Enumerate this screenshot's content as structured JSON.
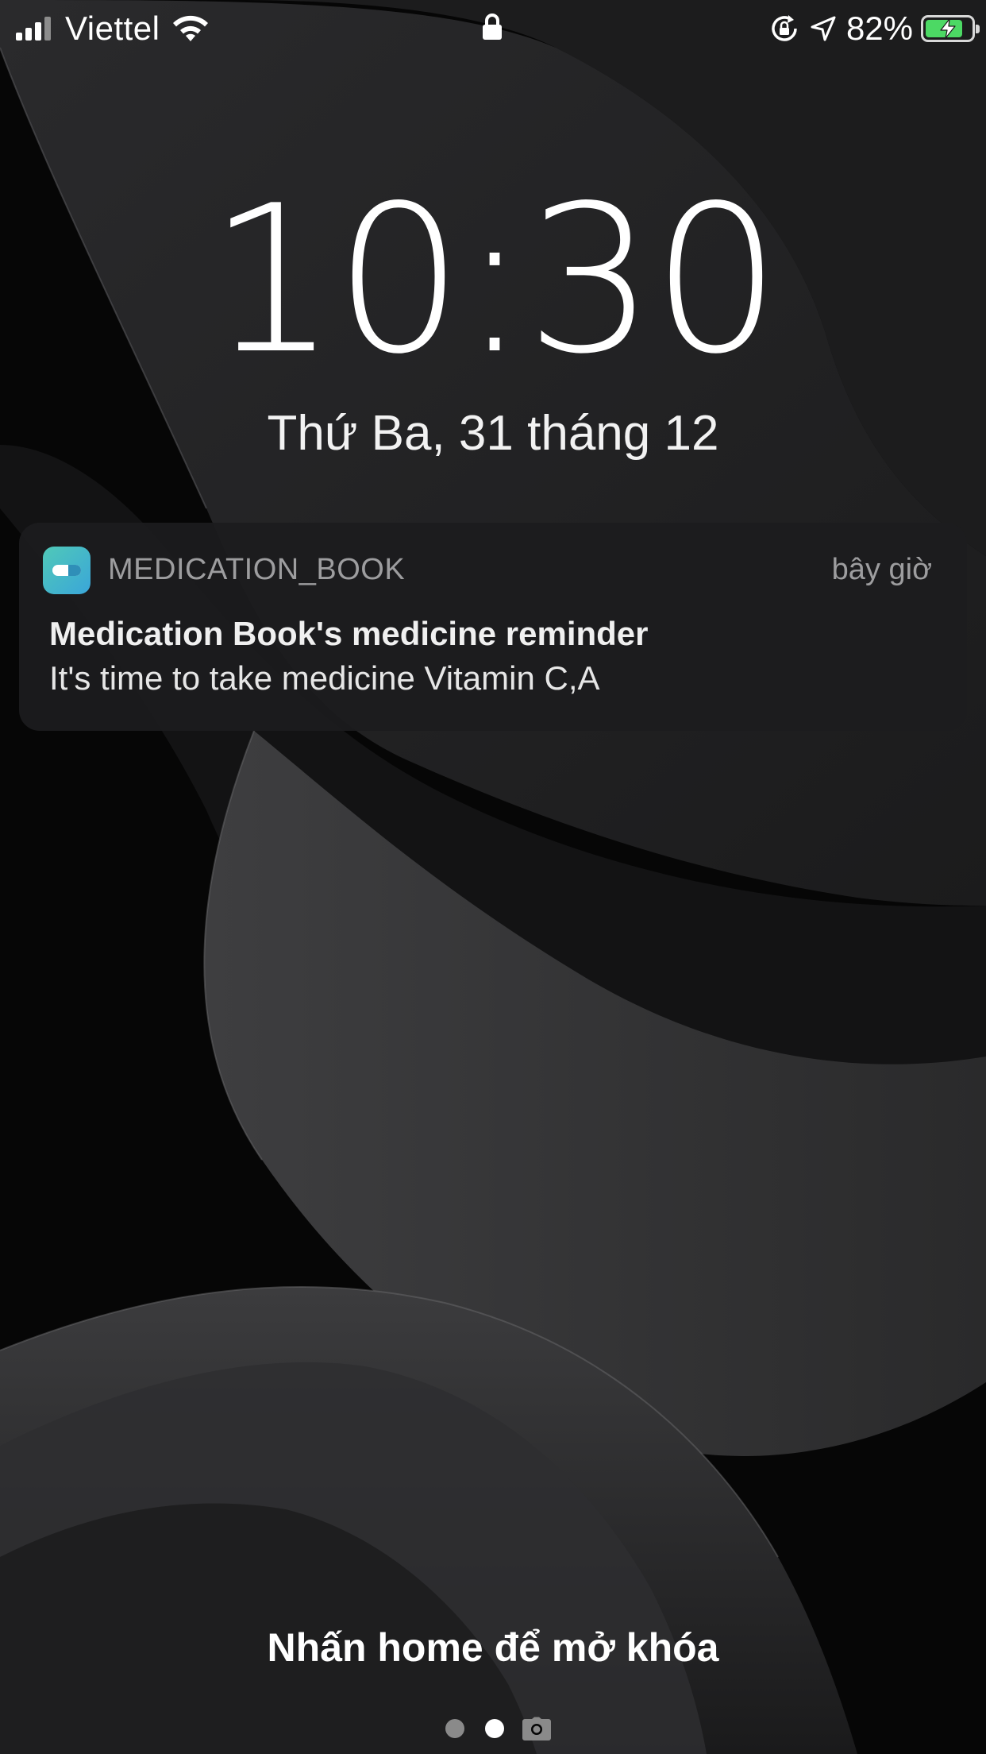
{
  "status_bar": {
    "carrier": "Viettel",
    "battery_percent": "82%",
    "battery_level": 0.82,
    "battery_color": "#4cd964",
    "icons": [
      "signal-bars-icon",
      "wifi-icon",
      "lock-icon",
      "rotation-lock-icon",
      "location-arrow-icon",
      "battery-charging-icon"
    ]
  },
  "lock_screen": {
    "time": "10:30",
    "date": "Thứ Ba, 31 tháng 12",
    "unlock_hint": "Nhấn home để mở khóa"
  },
  "notification": {
    "app_name": "MEDICATION_BOOK",
    "timestamp": "bây giờ",
    "title": "Medication Book's medicine reminder",
    "body": "It's time to take medicine Vitamin C,A",
    "icon": "pill-app-icon"
  },
  "pager": {
    "page_count": 2,
    "active_page": 2,
    "trailing_icon": "camera-icon"
  }
}
